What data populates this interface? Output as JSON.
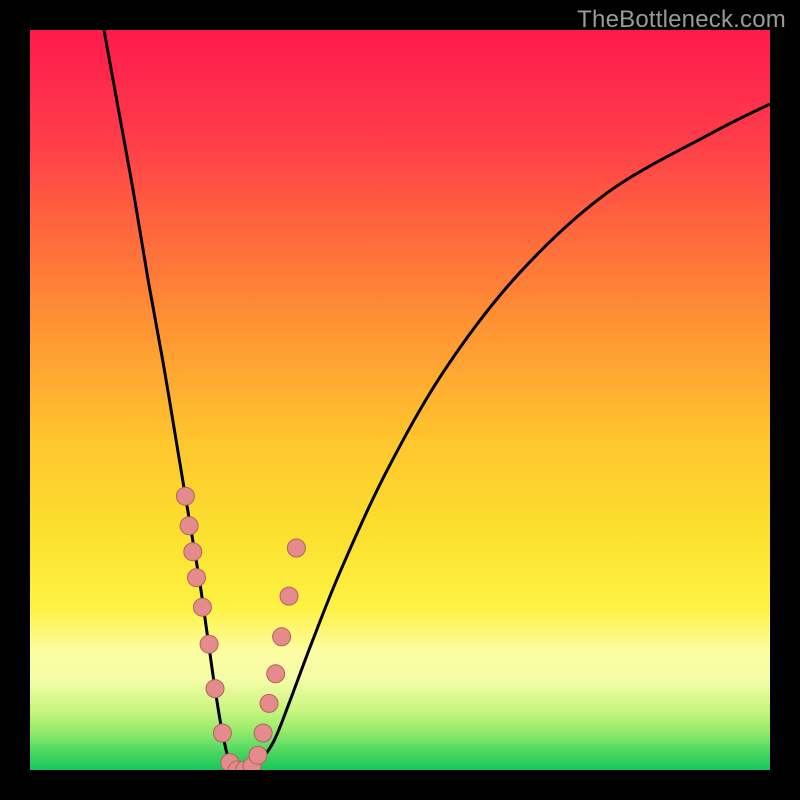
{
  "watermark": {
    "text": "TheBottleneck.com"
  },
  "colors": {
    "page_bg": "#000000",
    "gradient_stops": [
      {
        "pct": 0,
        "color": "#ff1a4d"
      },
      {
        "pct": 14,
        "color": "#ff3a4a"
      },
      {
        "pct": 28,
        "color": "#ff6a3c"
      },
      {
        "pct": 42,
        "color": "#ff9a33"
      },
      {
        "pct": 56,
        "color": "#ffc72e"
      },
      {
        "pct": 68,
        "color": "#fbe02e"
      },
      {
        "pct": 78,
        "color": "#fef243"
      },
      {
        "pct": 84,
        "color": "#fdfda3"
      },
      {
        "pct": 88,
        "color": "#f2fca6"
      },
      {
        "pct": 92,
        "color": "#c7f57e"
      },
      {
        "pct": 95,
        "color": "#8fe96a"
      },
      {
        "pct": 98,
        "color": "#3fd45f"
      },
      {
        "pct": 100,
        "color": "#19c75a"
      }
    ],
    "curve_stroke": "#000000",
    "marker_fill": "#e48c8c",
    "marker_stroke": "#b3625f"
  },
  "chart_data": {
    "type": "line",
    "title": "",
    "xlabel": "",
    "ylabel": "",
    "x_range": [
      0,
      100
    ],
    "y_range": [
      0,
      100
    ],
    "series": [
      {
        "name": "bottleneck-curve",
        "x": [
          10,
          12,
          14,
          16,
          18,
          20,
          21,
          22,
          23,
          24,
          25,
          26,
          27,
          28,
          29,
          30,
          31,
          33,
          35,
          38,
          42,
          48,
          56,
          66,
          78,
          92,
          100
        ],
        "y": [
          100,
          89,
          78,
          66,
          55,
          43,
          37,
          31,
          25,
          18,
          11,
          5,
          1,
          0,
          0,
          0,
          1,
          4,
          9,
          17,
          27,
          40,
          54,
          67,
          78,
          86,
          90
        ]
      }
    ],
    "markers": {
      "name": "highlighted-points",
      "x": [
        21.0,
        21.5,
        22.0,
        22.5,
        23.3,
        24.2,
        25.0,
        26.0,
        27.0,
        28.0,
        29.0,
        30.0,
        30.8,
        31.5,
        32.3,
        33.2,
        34.0,
        35.0,
        36.0
      ],
      "y": [
        37.0,
        33.0,
        29.5,
        26.0,
        22.0,
        17.0,
        11.0,
        5.0,
        1.0,
        0.0,
        0.0,
        0.5,
        2.0,
        5.0,
        9.0,
        13.0,
        18.0,
        23.5,
        30.0
      ]
    }
  }
}
